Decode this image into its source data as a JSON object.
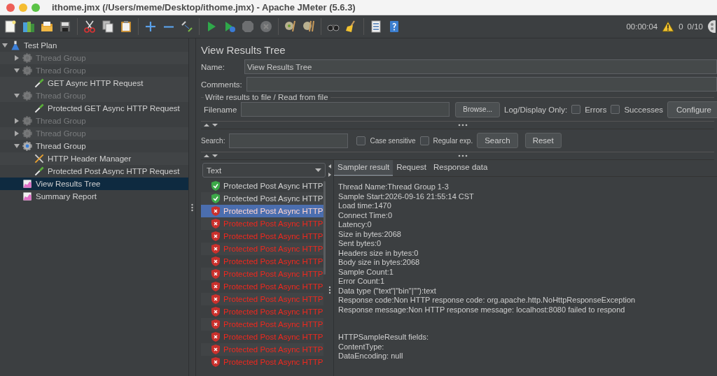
{
  "window": {
    "title": "ithome.jmx (/Users/meme/Desktop/ithome.jmx) - Apache JMeter (5.6.3)"
  },
  "status": {
    "elapsed": "00:00:04",
    "warnings": "0",
    "threads": "0/10"
  },
  "tree": [
    {
      "label": "Test Plan",
      "kind": "plan",
      "expanded": true,
      "disabled": false,
      "selected": false,
      "children": [
        {
          "label": "Thread Group",
          "kind": "thread-group",
          "expanded": false,
          "disabled": true,
          "selected": false
        },
        {
          "label": "Thread Group",
          "kind": "thread-group",
          "expanded": true,
          "disabled": true,
          "selected": false,
          "children": [
            {
              "label": "GET Async HTTP Request",
              "kind": "sampler",
              "disabled": false,
              "selected": false
            }
          ]
        },
        {
          "label": "Thread Group",
          "kind": "thread-group",
          "expanded": true,
          "disabled": true,
          "selected": false,
          "children": [
            {
              "label": "Protected GET Async HTTP Request",
              "kind": "sampler",
              "disabled": false,
              "selected": false
            }
          ]
        },
        {
          "label": "Thread Group",
          "kind": "thread-group",
          "expanded": false,
          "disabled": true,
          "selected": false
        },
        {
          "label": "Thread Group",
          "kind": "thread-group",
          "expanded": false,
          "disabled": true,
          "selected": false
        },
        {
          "label": "Thread Group",
          "kind": "thread-group",
          "expanded": true,
          "disabled": false,
          "selected": false,
          "children": [
            {
              "label": "HTTP Header Manager",
              "kind": "config",
              "disabled": false,
              "selected": false
            },
            {
              "label": "Protected Post Async HTTP Request",
              "kind": "sampler",
              "disabled": false,
              "selected": false
            }
          ]
        },
        {
          "label": "View Results Tree",
          "kind": "listener",
          "disabled": false,
          "selected": true
        },
        {
          "label": "Summary Report",
          "kind": "listener",
          "disabled": false,
          "selected": false
        }
      ]
    }
  ],
  "panel": {
    "title": "View Results Tree",
    "name": {
      "label": "Name:",
      "value": "View Results Tree"
    },
    "comments": {
      "label": "Comments:"
    },
    "file_group": {
      "legend": "Write results to file / Read from file",
      "filename_label": "Filename",
      "browse": "Browse...",
      "log_label": "Log/Display Only:",
      "errors": {
        "label": "Errors",
        "checked": false
      },
      "successes": {
        "label": "Successes",
        "checked": false
      },
      "configure": "Configure"
    },
    "search": {
      "label": "Search:",
      "case_sensitive": {
        "label": "Case sensitive",
        "checked": false
      },
      "regex": {
        "label": "Regular exp.",
        "checked": false
      },
      "search_button": "Search",
      "reset_button": "Reset"
    },
    "renderer": {
      "value": "Text"
    },
    "results": [
      {
        "label": "Protected Post Async HTTP",
        "success": true,
        "selected": false
      },
      {
        "label": "Protected Post Async HTTP",
        "success": true,
        "selected": false
      },
      {
        "label": "Protected Post Async HTTP",
        "success": false,
        "selected": true
      },
      {
        "label": "Protected Post Async HTTP",
        "success": false,
        "selected": false
      },
      {
        "label": "Protected Post Async HTTP",
        "success": false,
        "selected": false
      },
      {
        "label": "Protected Post Async HTTP",
        "success": false,
        "selected": false
      },
      {
        "label": "Protected Post Async HTTP",
        "success": false,
        "selected": false
      },
      {
        "label": "Protected Post Async HTTP",
        "success": false,
        "selected": false
      },
      {
        "label": "Protected Post Async HTTP",
        "success": false,
        "selected": false
      },
      {
        "label": "Protected Post Async HTTP",
        "success": false,
        "selected": false
      },
      {
        "label": "Protected Post Async HTTP",
        "success": false,
        "selected": false
      },
      {
        "label": "Protected Post Async HTTP",
        "success": false,
        "selected": false
      },
      {
        "label": "Protected Post Async HTTP",
        "success": false,
        "selected": false
      },
      {
        "label": "Protected Post Async HTTP",
        "success": false,
        "selected": false
      },
      {
        "label": "Protected Post Async HTTP",
        "success": false,
        "selected": false
      }
    ],
    "tabs": [
      {
        "label": "Sampler result",
        "selected": true
      },
      {
        "label": "Request",
        "selected": false
      },
      {
        "label": "Response data",
        "selected": false
      }
    ],
    "details": [
      [
        "Thread Name:Thread Group 1-3",
        "Sample Start:2026-09-16 21:55:14 CST",
        "Load time:1470",
        "Connect Time:0",
        "Latency:0",
        "Size in bytes:2068",
        "Sent bytes:0",
        "Headers size in bytes:0",
        "Body size in bytes:2068",
        "Sample Count:1",
        "Error Count:1",
        "Data type (\"text\"|\"bin\"|\"\"):text",
        "Response code:Non HTTP response code: org.apache.http.NoHttpResponseException",
        "Response message:Non HTTP response message: localhost:8080 failed to respond"
      ],
      [
        "HTTPSampleResult fields:",
        "ContentType:",
        "DataEncoding: null"
      ]
    ]
  }
}
